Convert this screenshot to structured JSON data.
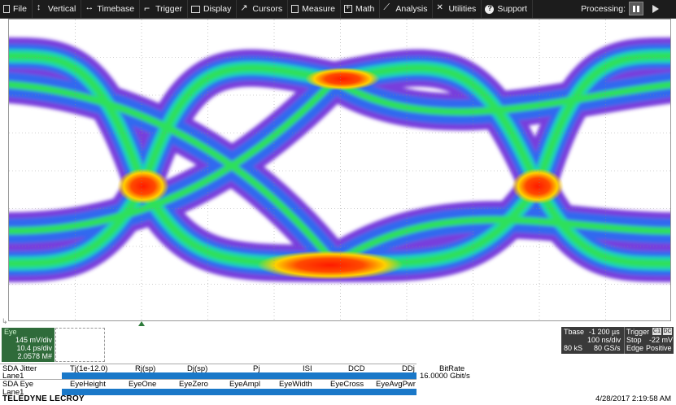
{
  "menu": {
    "items": [
      {
        "label": "File",
        "icon": "file-icon"
      },
      {
        "label": "Vertical",
        "icon": "vertical-icon"
      },
      {
        "label": "Timebase",
        "icon": "timebase-icon"
      },
      {
        "label": "Trigger",
        "icon": "trigger-icon"
      },
      {
        "label": "Display",
        "icon": "display-icon"
      },
      {
        "label": "Cursors",
        "icon": "cursors-icon"
      },
      {
        "label": "Measure",
        "icon": "measure-icon"
      },
      {
        "label": "Math",
        "icon": "math-icon"
      },
      {
        "label": "Analysis",
        "icon": "analysis-icon"
      },
      {
        "label": "Utilities",
        "icon": "utilities-icon"
      },
      {
        "label": "Support",
        "icon": "support-icon"
      }
    ],
    "processing_label": "Processing:"
  },
  "trace": {
    "name": "Eye",
    "vdiv": "145 mV/div",
    "hdiv": "10.4 ps/div",
    "extra": "2.0578 M#"
  },
  "timebase": {
    "label": "Tbase",
    "delay": "-1 200 µs",
    "vdiv": "100 ns/div",
    "samples": "80 kS",
    "rate": "80 GS/s"
  },
  "trigger": {
    "label": "Trigger",
    "ch_a": "C1",
    "ch_b": "DC",
    "mode": "Stop",
    "level": "-22 mV",
    "type": "Edge",
    "slope": "Positive"
  },
  "jitter": {
    "title": "SDA Jitter",
    "lane": "Lane1",
    "headers": [
      "Tj(1e-12.0)",
      "Rj(sp)",
      "Dj(sp)",
      "Pj",
      "ISI",
      "DCD",
      "DDj",
      "BitRate"
    ],
    "bitrate": "16.0000 Gbit/s"
  },
  "eye": {
    "title": "SDA Eye",
    "lane": "Lane1",
    "headers": [
      "EyeHeight",
      "EyeOne",
      "EyeZero",
      "EyeAmpl",
      "EyeWidth",
      "EyeCross",
      "EyeAvgPwr"
    ]
  },
  "brand": "TELEDYNE LECROY",
  "timestamp": "4/28/2017 2:19:58 AM",
  "colors": {
    "menubar": "#1c1c1c",
    "trace_descriptor": "#2f6b3a",
    "param_bar": "#1a78c8",
    "eye_low": "#6a2bd9",
    "eye_mid": "#19d46a",
    "eye_high": "#ff2a00"
  }
}
